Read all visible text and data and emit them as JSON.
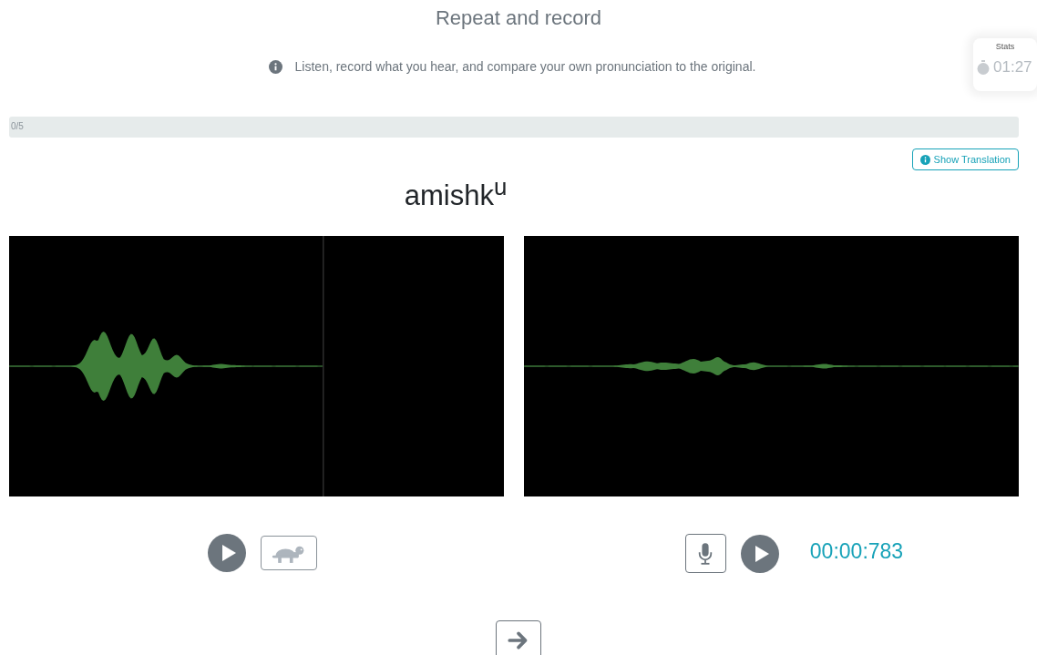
{
  "title": "Repeat and record",
  "instruction": "Listen, record what you hear, and compare your own pronunciation to the original.",
  "stats": {
    "title": "Stats",
    "time": "01:27"
  },
  "progress": {
    "label": "0/5",
    "level": 0
  },
  "show_translation_button": "Show Translation",
  "word": "amishk$^{u}$",
  "recording_time": "00:00:783"
}
